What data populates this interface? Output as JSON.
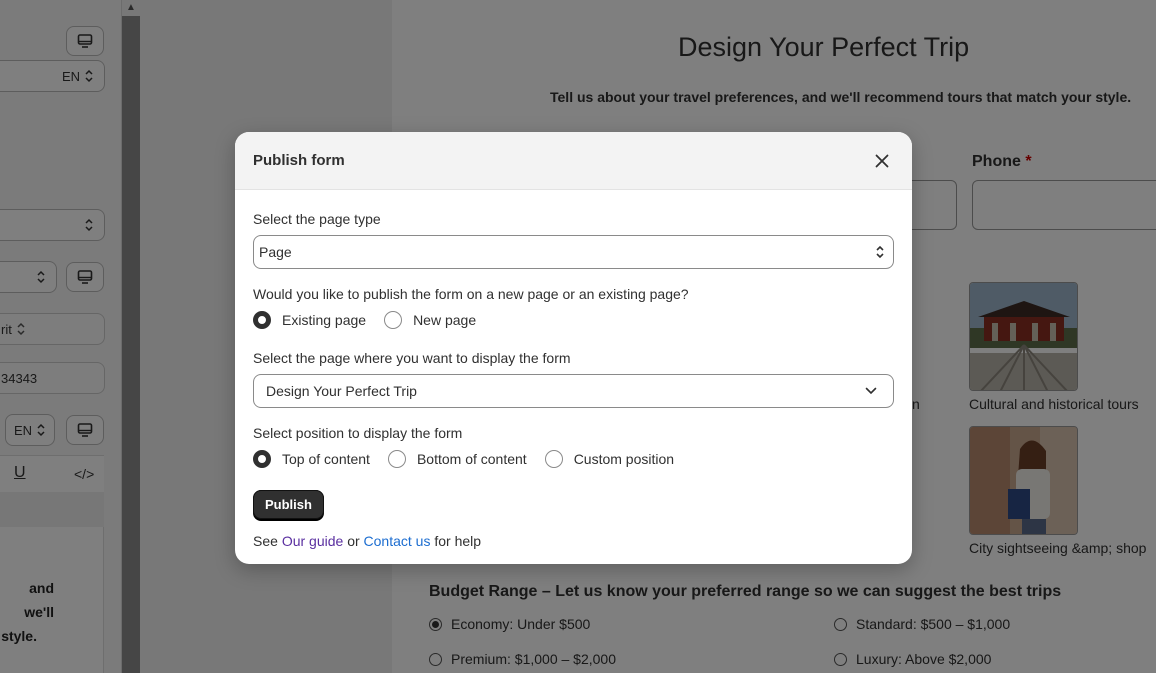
{
  "left_panel": {
    "lang_1": "EN",
    "field_partial": "rit",
    "field_number": "34343",
    "lang_2": "EN",
    "text_partial_1": "and we'll",
    "text_partial_2": "style."
  },
  "preview": {
    "title": "Design Your Perfect Trip",
    "subtitle": "Tell us about your travel preferences, and we'll recommend tours that match your style.",
    "phone_label": "Phone",
    "required_mark": "*",
    "caption_partial": "n",
    "caption_cultural": "Cultural and historical tours",
    "caption_city": "City sightseeing &amp; shop",
    "budget_title": "Budget Range – Let us know your preferred range so we can suggest the best trips",
    "budget_options": [
      {
        "label": "Economy: Under $500",
        "selected": true
      },
      {
        "label": "Standard: $500 – $1,000",
        "selected": false
      },
      {
        "label": "Premium: $1,000 – $2,000",
        "selected": false
      },
      {
        "label": "Luxury: Above $2,000",
        "selected": false
      }
    ]
  },
  "modal": {
    "title": "Publish form",
    "page_type_label": "Select the page type",
    "page_type_value": "Page",
    "publish_where_label": "Would you like to publish the form on a new page or an existing page?",
    "publish_where_options": [
      {
        "label": "Existing page",
        "selected": true
      },
      {
        "label": "New page",
        "selected": false
      }
    ],
    "target_page_label": "Select the page where you want to display the form",
    "target_page_value": "Design Your Perfect Trip",
    "position_label": "Select position to display the form",
    "position_options": [
      {
        "label": "Top of content",
        "selected": true
      },
      {
        "label": "Bottom of content",
        "selected": false
      },
      {
        "label": "Custom position",
        "selected": false
      }
    ],
    "publish_button": "Publish",
    "help_prefix": "See",
    "help_guide": "Our guide",
    "help_or": "or",
    "help_contact": "Contact us",
    "help_suffix": "for help"
  },
  "icons": {
    "close": "close-icon",
    "desktop": "desktop-icon",
    "select_arrows": "chevron-up-down-icon",
    "dropdown": "chevron-down-icon"
  }
}
